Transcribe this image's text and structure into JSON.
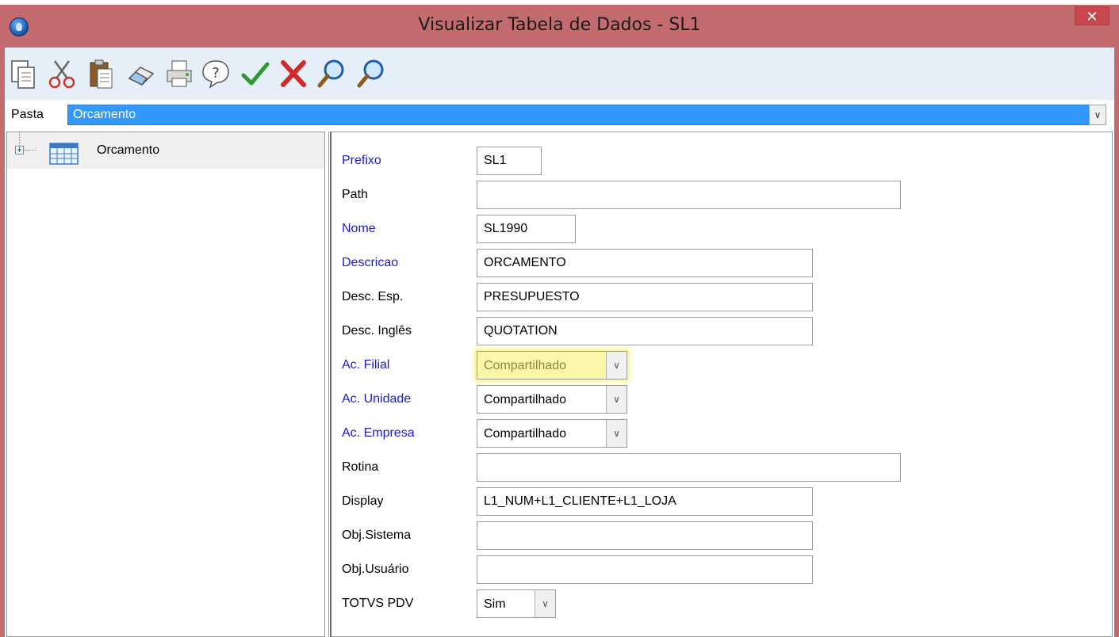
{
  "window": {
    "title": "Visualizar Tabela de Dados - SL1",
    "close_label": "✕"
  },
  "toolbar": {
    "buttons": [
      {
        "icon": "copy-icon"
      },
      {
        "icon": "cut-icon"
      },
      {
        "icon": "paste-icon"
      },
      {
        "icon": "eraser-icon"
      },
      {
        "icon": "print-icon"
      },
      {
        "icon": "help-icon"
      },
      {
        "icon": "confirm-check-icon"
      },
      {
        "icon": "cancel-x-icon"
      },
      {
        "icon": "search-icon"
      },
      {
        "icon": "search-next-icon"
      }
    ]
  },
  "pasta": {
    "label": "Pasta",
    "value": "Orcamento"
  },
  "tree": {
    "expander": "+",
    "root_label": "Orcamento"
  },
  "form": {
    "prefixo": {
      "label": "Prefixo",
      "value": "SL1"
    },
    "path": {
      "label": "Path",
      "value": ""
    },
    "nome": {
      "label": "Nome",
      "value": "SL1990"
    },
    "descricao": {
      "label": "Descricao",
      "value": "ORCAMENTO"
    },
    "desc_esp": {
      "label": "Desc. Esp.",
      "value": "PRESUPUESTO"
    },
    "desc_ingles": {
      "label": "Desc. Inglês",
      "value": "QUOTATION"
    },
    "ac_filial": {
      "label": "Ac. Filial",
      "value": "Compartilhado"
    },
    "ac_unidade": {
      "label": "Ac. Unidade",
      "value": "Compartilhado"
    },
    "ac_empresa": {
      "label": "Ac. Empresa",
      "value": "Compartilhado"
    },
    "rotina": {
      "label": "Rotina",
      "value": ""
    },
    "display": {
      "label": "Display",
      "value": "L1_NUM+L1_CLIENTE+L1_LOJA"
    },
    "obj_sistema": {
      "label": "Obj.Sistema",
      "value": ""
    },
    "obj_usuario": {
      "label": "Obj.Usuário",
      "value": ""
    },
    "totvs_pdv": {
      "label": "TOTVS PDV",
      "value": "Sim"
    }
  },
  "colors": {
    "titlebar": "#c46b70",
    "selection": "#3399ff",
    "required_label": "#1a1ad6",
    "highlight": "#fbf7a8"
  }
}
